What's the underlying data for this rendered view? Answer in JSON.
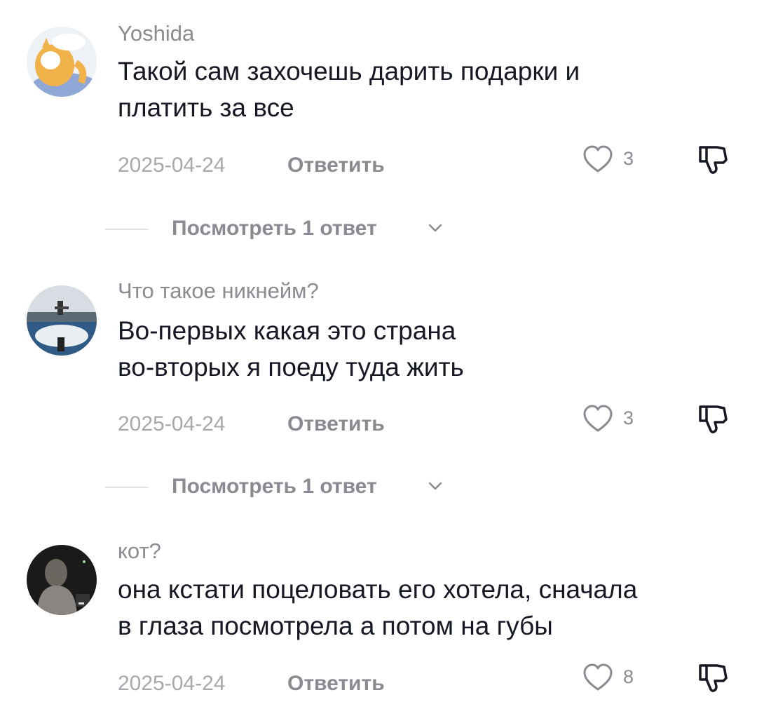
{
  "comments": [
    {
      "username": "Yoshida",
      "text_lines": [
        "Такой сам захочешь дарить подарки и",
        "платить за все"
      ],
      "date": "2025-04-24",
      "reply_label": "Ответить",
      "likes": "3",
      "view_replies_label": "Посмотреть 1 ответ"
    },
    {
      "username": "Что такое никнейм?",
      "text_lines": [
        "Во-первых какая это страна",
        "во-вторых я поеду туда жить"
      ],
      "date": "2025-04-24",
      "reply_label": "Ответить",
      "likes": "3",
      "view_replies_label": "Посмотреть 1 ответ"
    },
    {
      "username": "кот?",
      "text_lines": [
        "она кстати поцеловать его хотела, сначала",
        "в глаза посмотрела а потом на губы"
      ],
      "date": "2025-04-24",
      "reply_label": "Ответить",
      "likes": "8"
    }
  ],
  "icons": {
    "like": "heart-outline-icon",
    "dislike": "thumbs-down-icon",
    "expand": "chevron-down-icon"
  },
  "colors": {
    "text": "#161823",
    "secondary": "#8a8b91",
    "date": "#a7a8ad",
    "divider": "#e3e3e5"
  }
}
